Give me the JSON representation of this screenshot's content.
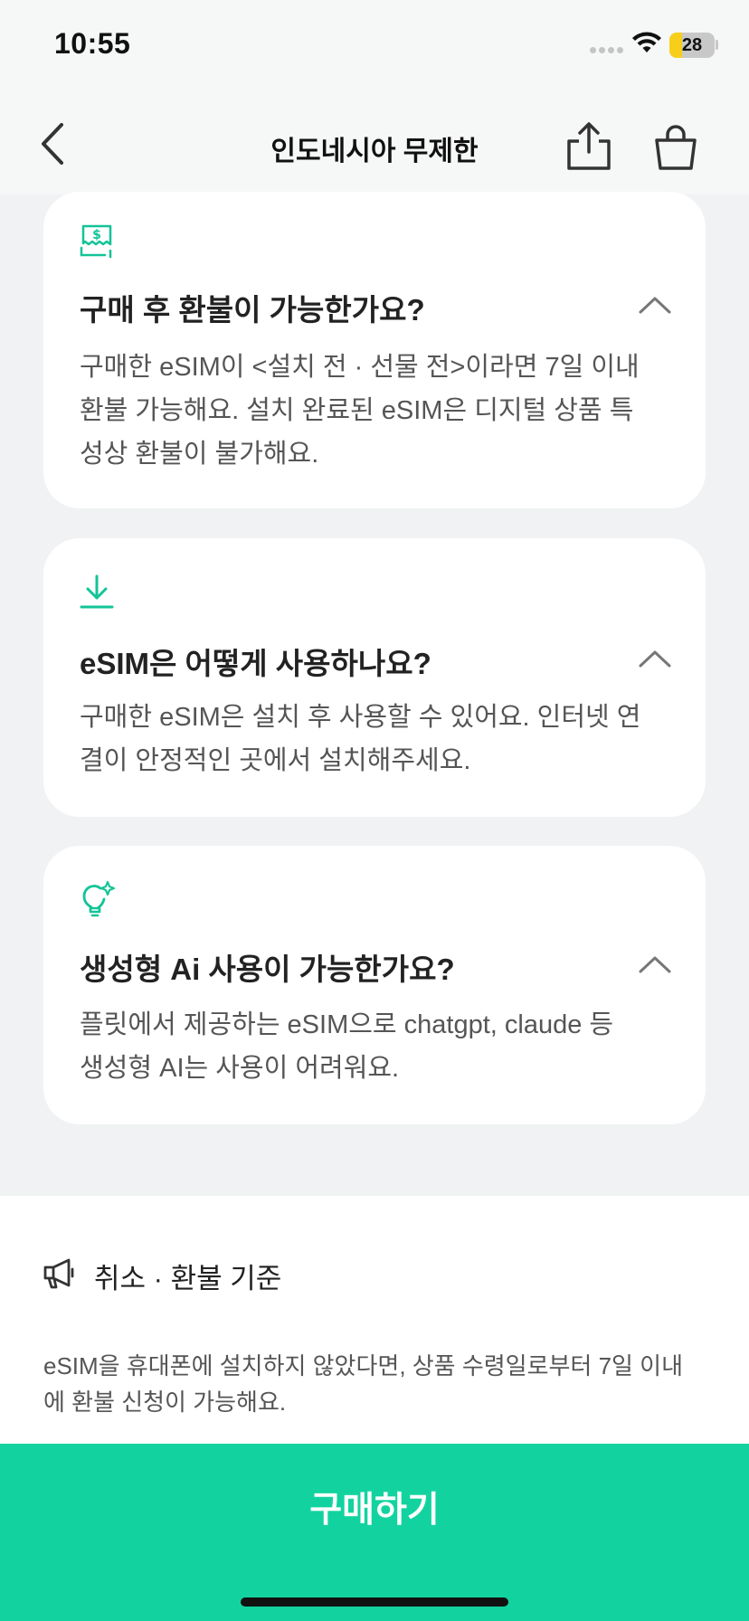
{
  "status_bar": {
    "time": "10:55",
    "battery_level": "28",
    "battery_fraction": 0.28
  },
  "nav": {
    "title": "인도네시아 무제한",
    "back_icon": "chevron-left-icon",
    "share_icon": "share-icon",
    "cart_icon": "shopping-bag-icon"
  },
  "faq": [
    {
      "icon": "receipt-dollar-icon",
      "question": "구매 후 환불이 가능한가요?",
      "answer_lines": [
        "구매한 eSIM이 <설치 전 · 선물 전>이라면 7일 이내",
        "환불 가능해요. 설치 완료된 eSIM은 디지털 상품 특",
        "성상 환불이 불가해요."
      ],
      "expanded": true
    },
    {
      "icon": "download-icon",
      "question": "eSIM은 어떻게 사용하나요?",
      "answer_lines": [
        "구매한 eSIM은 설치 후 사용할 수 있어요. 인터넷 연",
        "결이 안정적인 곳에서 설치해주세요."
      ],
      "expanded": true
    },
    {
      "icon": "lightbulb-sparkle-icon",
      "question": "생성형 Ai 사용이 가능한가요?",
      "answer_lines": [
        "플릿에서 제공하는 eSIM으로 chatgpt, claude 등",
        "생성형 AI는 사용이 어려워요."
      ],
      "expanded": true
    }
  ],
  "policy": {
    "icon": "megaphone-icon",
    "title": "취소 · 환불 기준",
    "text_lines": [
      "eSIM을 휴대폰에 설치하지 않았다면, 상품 수령일로부터 7일 이내",
      "에 환불 신청이 가능해요."
    ]
  },
  "buy_button": {
    "label": "구매하기"
  },
  "colors": {
    "accent": "#12d3a0",
    "background": "#f1f2f3",
    "card": "#ffffff"
  }
}
